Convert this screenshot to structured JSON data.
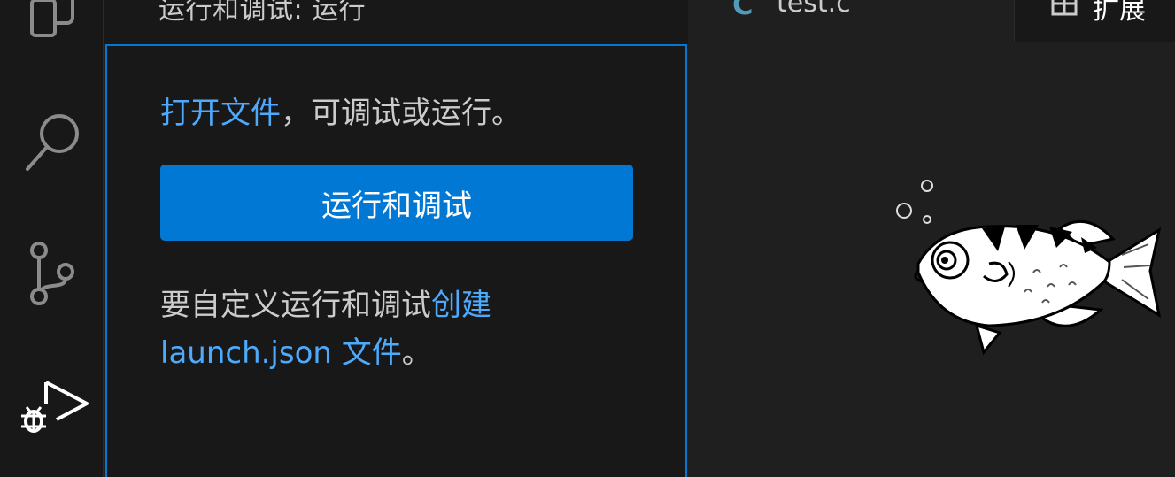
{
  "sidebar": {
    "title": "运行和调试: 运行",
    "open_file_link": "打开文件",
    "open_file_suffix": "，可调试或运行。",
    "run_button": "运行和调试",
    "customize_prefix": "要自定义运行和调试",
    "create_link": "创建",
    "launch_link": "launch.json 文件",
    "customize_suffix": "。"
  },
  "tabs": [
    {
      "icon": "c-file-icon",
      "icon_text": "C",
      "label": "test.c"
    },
    {
      "icon": "extensions-icon",
      "label": "扩展"
    }
  ],
  "activity_bar": {
    "items": [
      {
        "icon": "explorer-icon"
      },
      {
        "icon": "search-icon"
      },
      {
        "icon": "source-control-icon"
      },
      {
        "icon": "run-debug-icon"
      }
    ]
  },
  "colors": {
    "accent": "#0078d4",
    "link": "#4daafc",
    "background": "#1f1f1f",
    "sidebar_bg": "#181818"
  }
}
